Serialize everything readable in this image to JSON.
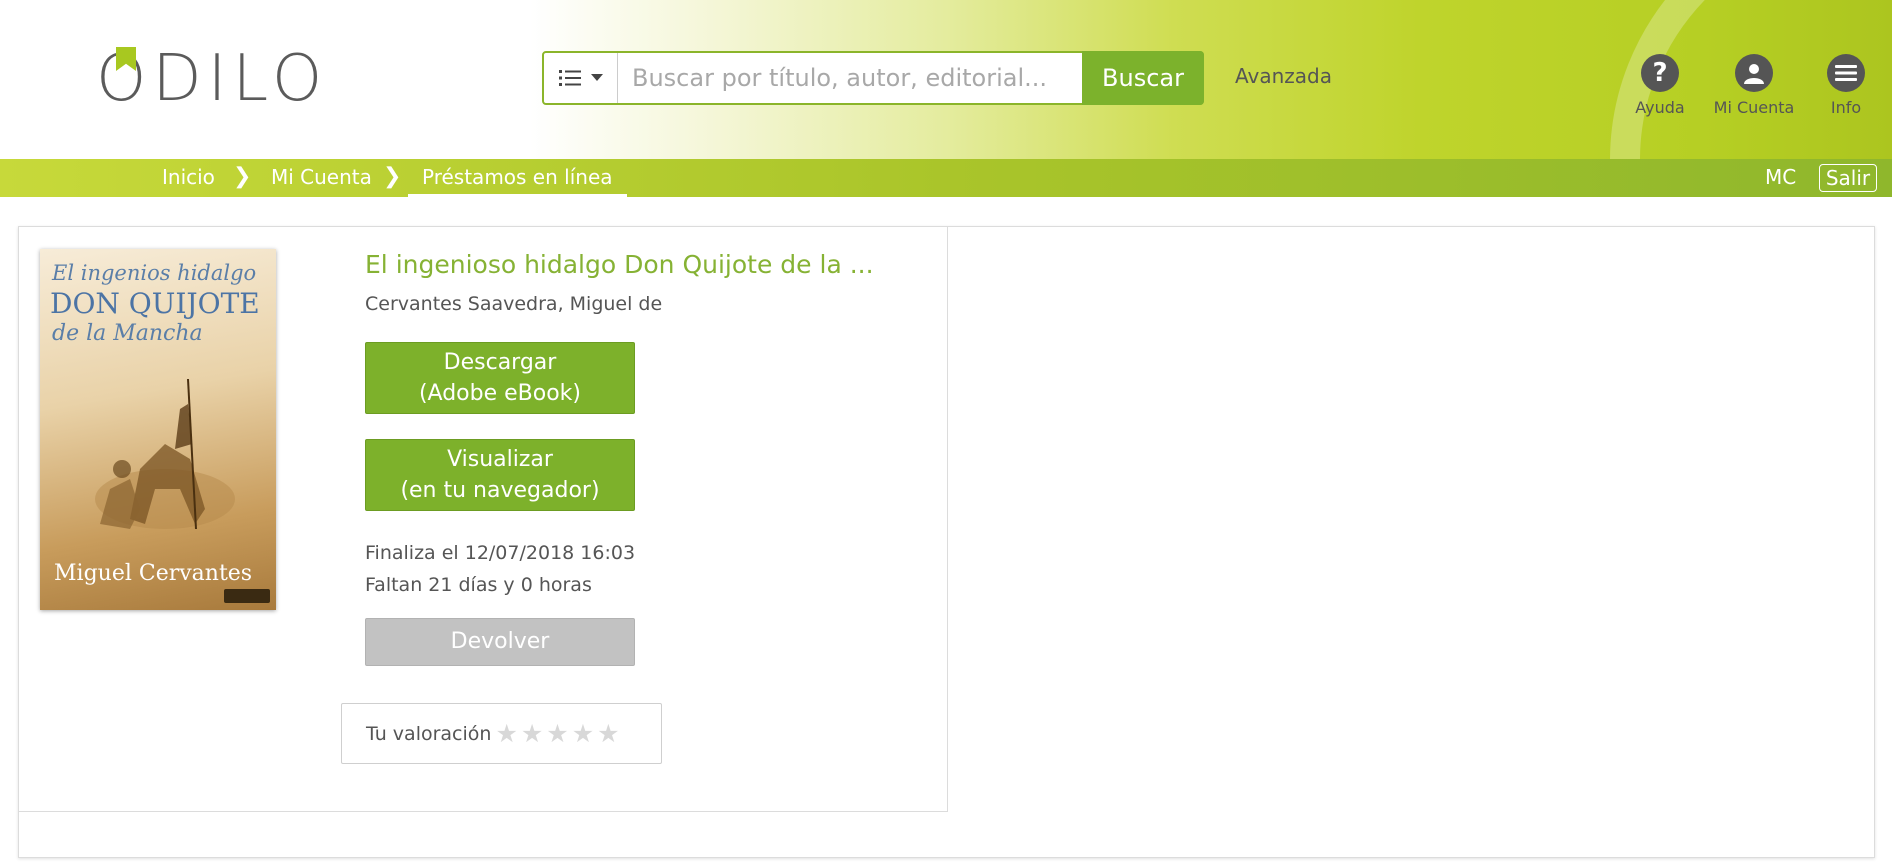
{
  "header": {
    "logo_text": "ODILO",
    "search": {
      "placeholder": "Buscar por título, autor, editorial...",
      "button_label": "Buscar",
      "type_icon": "list-icon"
    },
    "advanced_label": "Avanzada",
    "icons": [
      {
        "label": "Ayuda",
        "icon": "help-icon"
      },
      {
        "label": "Mi Cuenta",
        "icon": "user-icon"
      },
      {
        "label": "Info",
        "icon": "menu-icon"
      }
    ]
  },
  "breadcrumb": {
    "items": [
      "Inicio",
      "Mi Cuenta",
      "Préstamos en línea"
    ],
    "user_initials": "MC",
    "logout_label": "Salir"
  },
  "loan": {
    "cover": {
      "line1": "El ingenios hidalgo",
      "line2": "DON QUIJOTE",
      "line3": "de la Mancha",
      "author": "Miguel Cervantes"
    },
    "title": "El ingenioso hidalgo Don Quijote de la ...",
    "author": "Cervantes Saavedra, Miguel de",
    "download": {
      "line1": "Descargar",
      "line2": "(Adobe eBook)"
    },
    "view": {
      "line1": "Visualizar",
      "line2": "(en tu navegador)"
    },
    "due_line": "Finaliza el 12/07/2018 16:03",
    "remaining_line": "Faltan 21 días y 0 horas",
    "return_label": "Devolver",
    "rating": {
      "label": "Tu valoración",
      "value": 0,
      "max": 5
    }
  },
  "colors": {
    "brand_green": "#7db12b",
    "title_green": "#86b234",
    "disabled_gray": "#c2c2c2"
  }
}
